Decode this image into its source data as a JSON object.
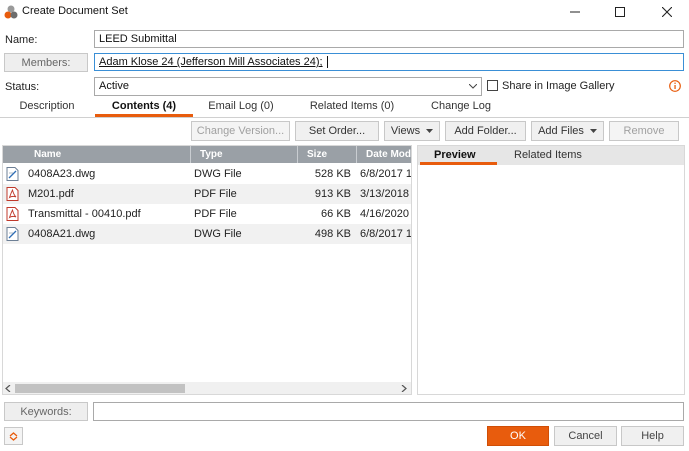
{
  "window": {
    "title": "Create Document Set",
    "minimize_icon": "minimize-icon",
    "maximize_icon": "maximize-icon",
    "close_icon": "close-icon"
  },
  "form": {
    "name_label": "Name:",
    "name_value": "LEED Submittal",
    "members_button": "Members:",
    "members_value": "Adam Klose 24 (Jefferson Mill Associates 24);",
    "status_label": "Status:",
    "status_value": "Active",
    "share_label": "Share in Image Gallery",
    "share_checked": false
  },
  "tabs": [
    {
      "label": "Description",
      "active": false
    },
    {
      "label": "Contents (4)",
      "active": true
    },
    {
      "label": "Email Log (0)",
      "active": false
    },
    {
      "label": "Related Items (0)",
      "active": false
    },
    {
      "label": "Change Log",
      "active": false
    }
  ],
  "toolbar": {
    "change_version": "Change Version...",
    "set_order": "Set Order...",
    "views": "Views",
    "add_folder": "Add Folder...",
    "add_files": "Add Files",
    "remove": "Remove"
  },
  "table": {
    "columns": [
      "Name",
      "Type",
      "Size",
      "Date Mod"
    ],
    "rows": [
      {
        "name": "0408A23.dwg",
        "type": "DWG File",
        "size": "528 KB",
        "date": "6/8/2017 1",
        "icon": "dwg-file-icon"
      },
      {
        "name": "M201.pdf",
        "type": "PDF File",
        "size": "913 KB",
        "date": "3/13/2018",
        "icon": "pdf-file-icon"
      },
      {
        "name": "Transmittal - 00410.pdf",
        "type": "PDF File",
        "size": "66 KB",
        "date": "4/16/2020",
        "icon": "pdf-file-icon"
      },
      {
        "name": "0408A21.dwg",
        "type": "DWG File",
        "size": "498 KB",
        "date": "6/8/2017 1",
        "icon": "dwg-file-icon"
      }
    ]
  },
  "preview": {
    "tabs": [
      "Preview",
      "Related Items"
    ]
  },
  "footer": {
    "keywords_button": "Keywords:",
    "keywords_value": "",
    "ok": "OK",
    "cancel": "Cancel",
    "help": "Help"
  },
  "colors": {
    "accent": "#e85c0d",
    "header": "#9aa0a6"
  }
}
